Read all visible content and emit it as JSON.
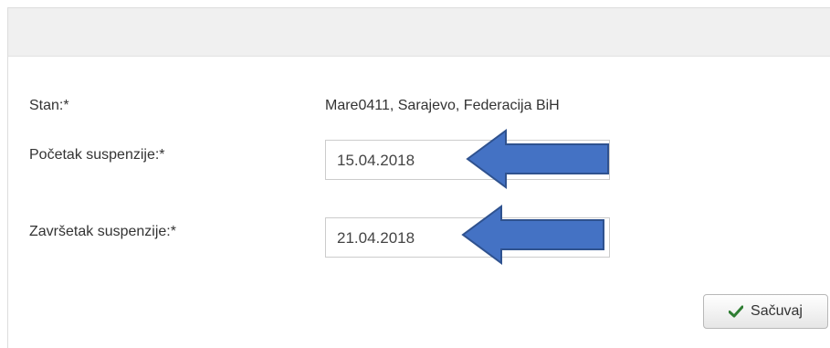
{
  "form": {
    "stan_label": "Stan:*",
    "stan_value": "Mare0411, Sarajevo, Federacija BiH",
    "start_label": "Početak suspenzije:*",
    "start_value": "15.04.2018",
    "end_label": "Završetak suspenzije:*",
    "end_value": "21.04.2018"
  },
  "actions": {
    "save_label": "Sačuvaj"
  },
  "colors": {
    "arrow_fill": "#4472c4",
    "arrow_stroke": "#2f528f",
    "check": "#2e7d32"
  },
  "icons": {
    "save": "check-icon",
    "pointer": "left-arrow"
  }
}
